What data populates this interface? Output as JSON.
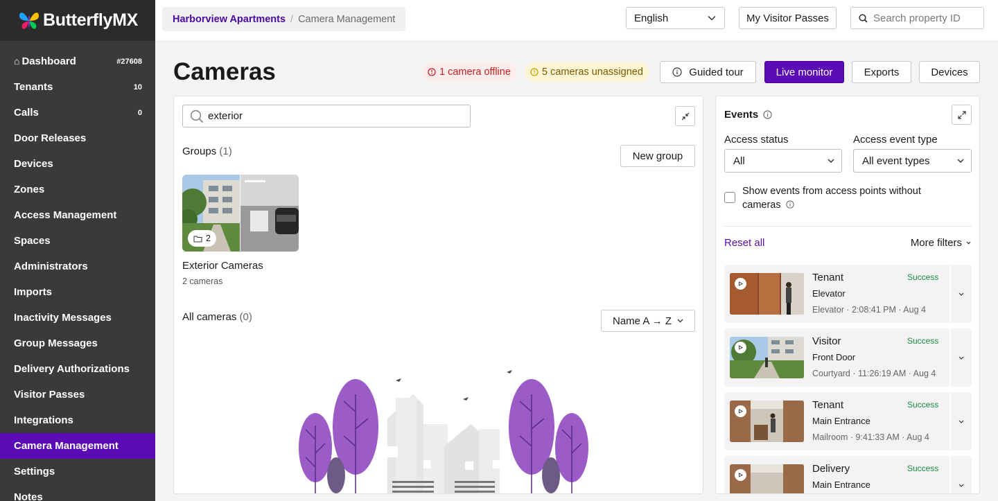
{
  "app": {
    "brand": "ButterflyMX",
    "brand_colors": [
      "#1aa3ff",
      "#ffc107",
      "#e91e63",
      "#7b2fd9",
      "#00c853"
    ]
  },
  "sidebar": {
    "items": [
      {
        "label": "Dashboard",
        "count": "#27608",
        "icon": "home-icon"
      },
      {
        "label": "Tenants",
        "count": "10"
      },
      {
        "label": "Calls",
        "count": "0"
      },
      {
        "label": "Door Releases",
        "count": ""
      },
      {
        "label": "Devices",
        "count": ""
      },
      {
        "label": "Zones",
        "count": ""
      },
      {
        "label": "Access Management",
        "count": ""
      },
      {
        "label": "Spaces",
        "count": ""
      },
      {
        "label": "Administrators",
        "count": ""
      },
      {
        "label": "Imports",
        "count": ""
      },
      {
        "label": "Inactivity Messages",
        "count": ""
      },
      {
        "label": "Group Messages",
        "count": ""
      },
      {
        "label": "Delivery Authorizations",
        "count": ""
      },
      {
        "label": "Visitor Passes",
        "count": ""
      },
      {
        "label": "Integrations",
        "count": ""
      },
      {
        "label": "Camera Management",
        "count": "",
        "active": true
      },
      {
        "label": "Settings",
        "count": ""
      },
      {
        "label": "Notes",
        "count": ""
      }
    ]
  },
  "topbar": {
    "breadcrumb_property": "Harborview Apartments",
    "breadcrumb_separator": "/",
    "breadcrumb_current": "Camera Management",
    "language": "English",
    "visitor_passes_button": "My Visitor Passes",
    "search_placeholder": "Search property ID"
  },
  "header": {
    "title": "Cameras",
    "offline_alert": "1 camera offline",
    "unassigned_alert": "5 cameras unassigned",
    "guided_tour": "Guided tour",
    "live_monitor": "Live monitor",
    "exports": "Exports",
    "devices": "Devices"
  },
  "main": {
    "search_value": "exterior",
    "groups_label": "Groups",
    "groups_count": "(1)",
    "new_group_button": "New group",
    "group": {
      "thumb_count": "2",
      "name": "Exterior Cameras",
      "subtitle": "2 cameras"
    },
    "all_cameras_label": "All cameras",
    "all_cameras_count": "(0)",
    "sort_label": "Name A → Z"
  },
  "events": {
    "title": "Events",
    "access_status_label": "Access status",
    "access_status_value": "All",
    "event_type_label": "Access event type",
    "event_type_value": "All event types",
    "checkbox_label": "Show events from access points without cameras",
    "reset_all": "Reset all",
    "more_filters": "More filters",
    "items": [
      {
        "role": "Tenant",
        "status": "Success",
        "point": "Elevator",
        "meta": "Elevator · 2:08:41 PM · Aug 4"
      },
      {
        "role": "Visitor",
        "status": "Success",
        "point": "Front Door",
        "meta": "Courtyard · 11:26:19 AM · Aug 4"
      },
      {
        "role": "Tenant",
        "status": "Success",
        "point": "Main Entrance",
        "meta": "Mailroom · 9:41:33 AM · Aug 4"
      },
      {
        "role": "Delivery",
        "status": "Success",
        "point": "Main Entrance",
        "meta": ""
      }
    ]
  },
  "colors": {
    "accent": "#5a0bb5",
    "sidebar_bg": "#3a3a3a",
    "success": "#1a8a45",
    "offline": "#c32020",
    "unassigned": "#7a5a00"
  }
}
